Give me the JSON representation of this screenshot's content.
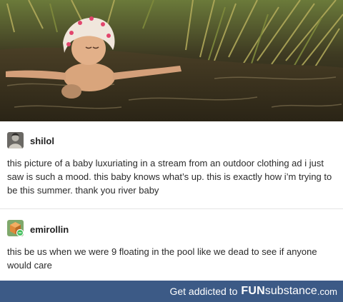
{
  "photo": {
    "subject": "baby floating in a stream"
  },
  "posts": [
    {
      "username": "shilol",
      "avatar_icon": "user-avatar-icon",
      "text": "this picture of a baby luxuriating in a stream from an outdoor clothing ad i just saw is such a mood. this baby knows what’s up. this is exactly how i’m trying to be this summer. thank you river baby"
    },
    {
      "username": "emirollin",
      "avatar_icon": "cube-avatar-icon",
      "text": "this be us when we were 9 floating in the pool like we dead to see if anyone would care"
    }
  ],
  "footer": {
    "prefix": "Get addicted to",
    "brand_fun": "FUN",
    "brand_substance": "substance",
    "brand_tld": ".com",
    "background": "#3c5a86"
  }
}
